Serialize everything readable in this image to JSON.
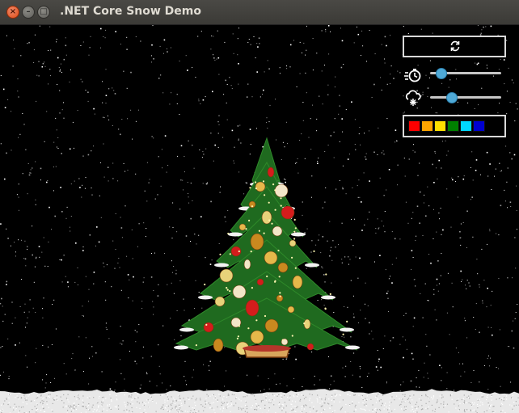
{
  "window": {
    "title": ".NET Core Snow Demo",
    "buttons": [
      "close",
      "minimize",
      "maximize"
    ]
  },
  "controls": {
    "refresh_icon": "refresh-icon",
    "speed": {
      "icon": "speed-timer-icon",
      "value": 0.15
    },
    "snowfall": {
      "icon": "snow-cloud-icon",
      "value": 0.3
    },
    "colors": [
      "#ff0000",
      "#ffa500",
      "#ffe000",
      "#008000",
      "#00d8ff",
      "#0000d0"
    ]
  },
  "scene": {
    "background": "#000000",
    "snow_color": "#ffffff",
    "tree_color": "#1f6a1f"
  }
}
